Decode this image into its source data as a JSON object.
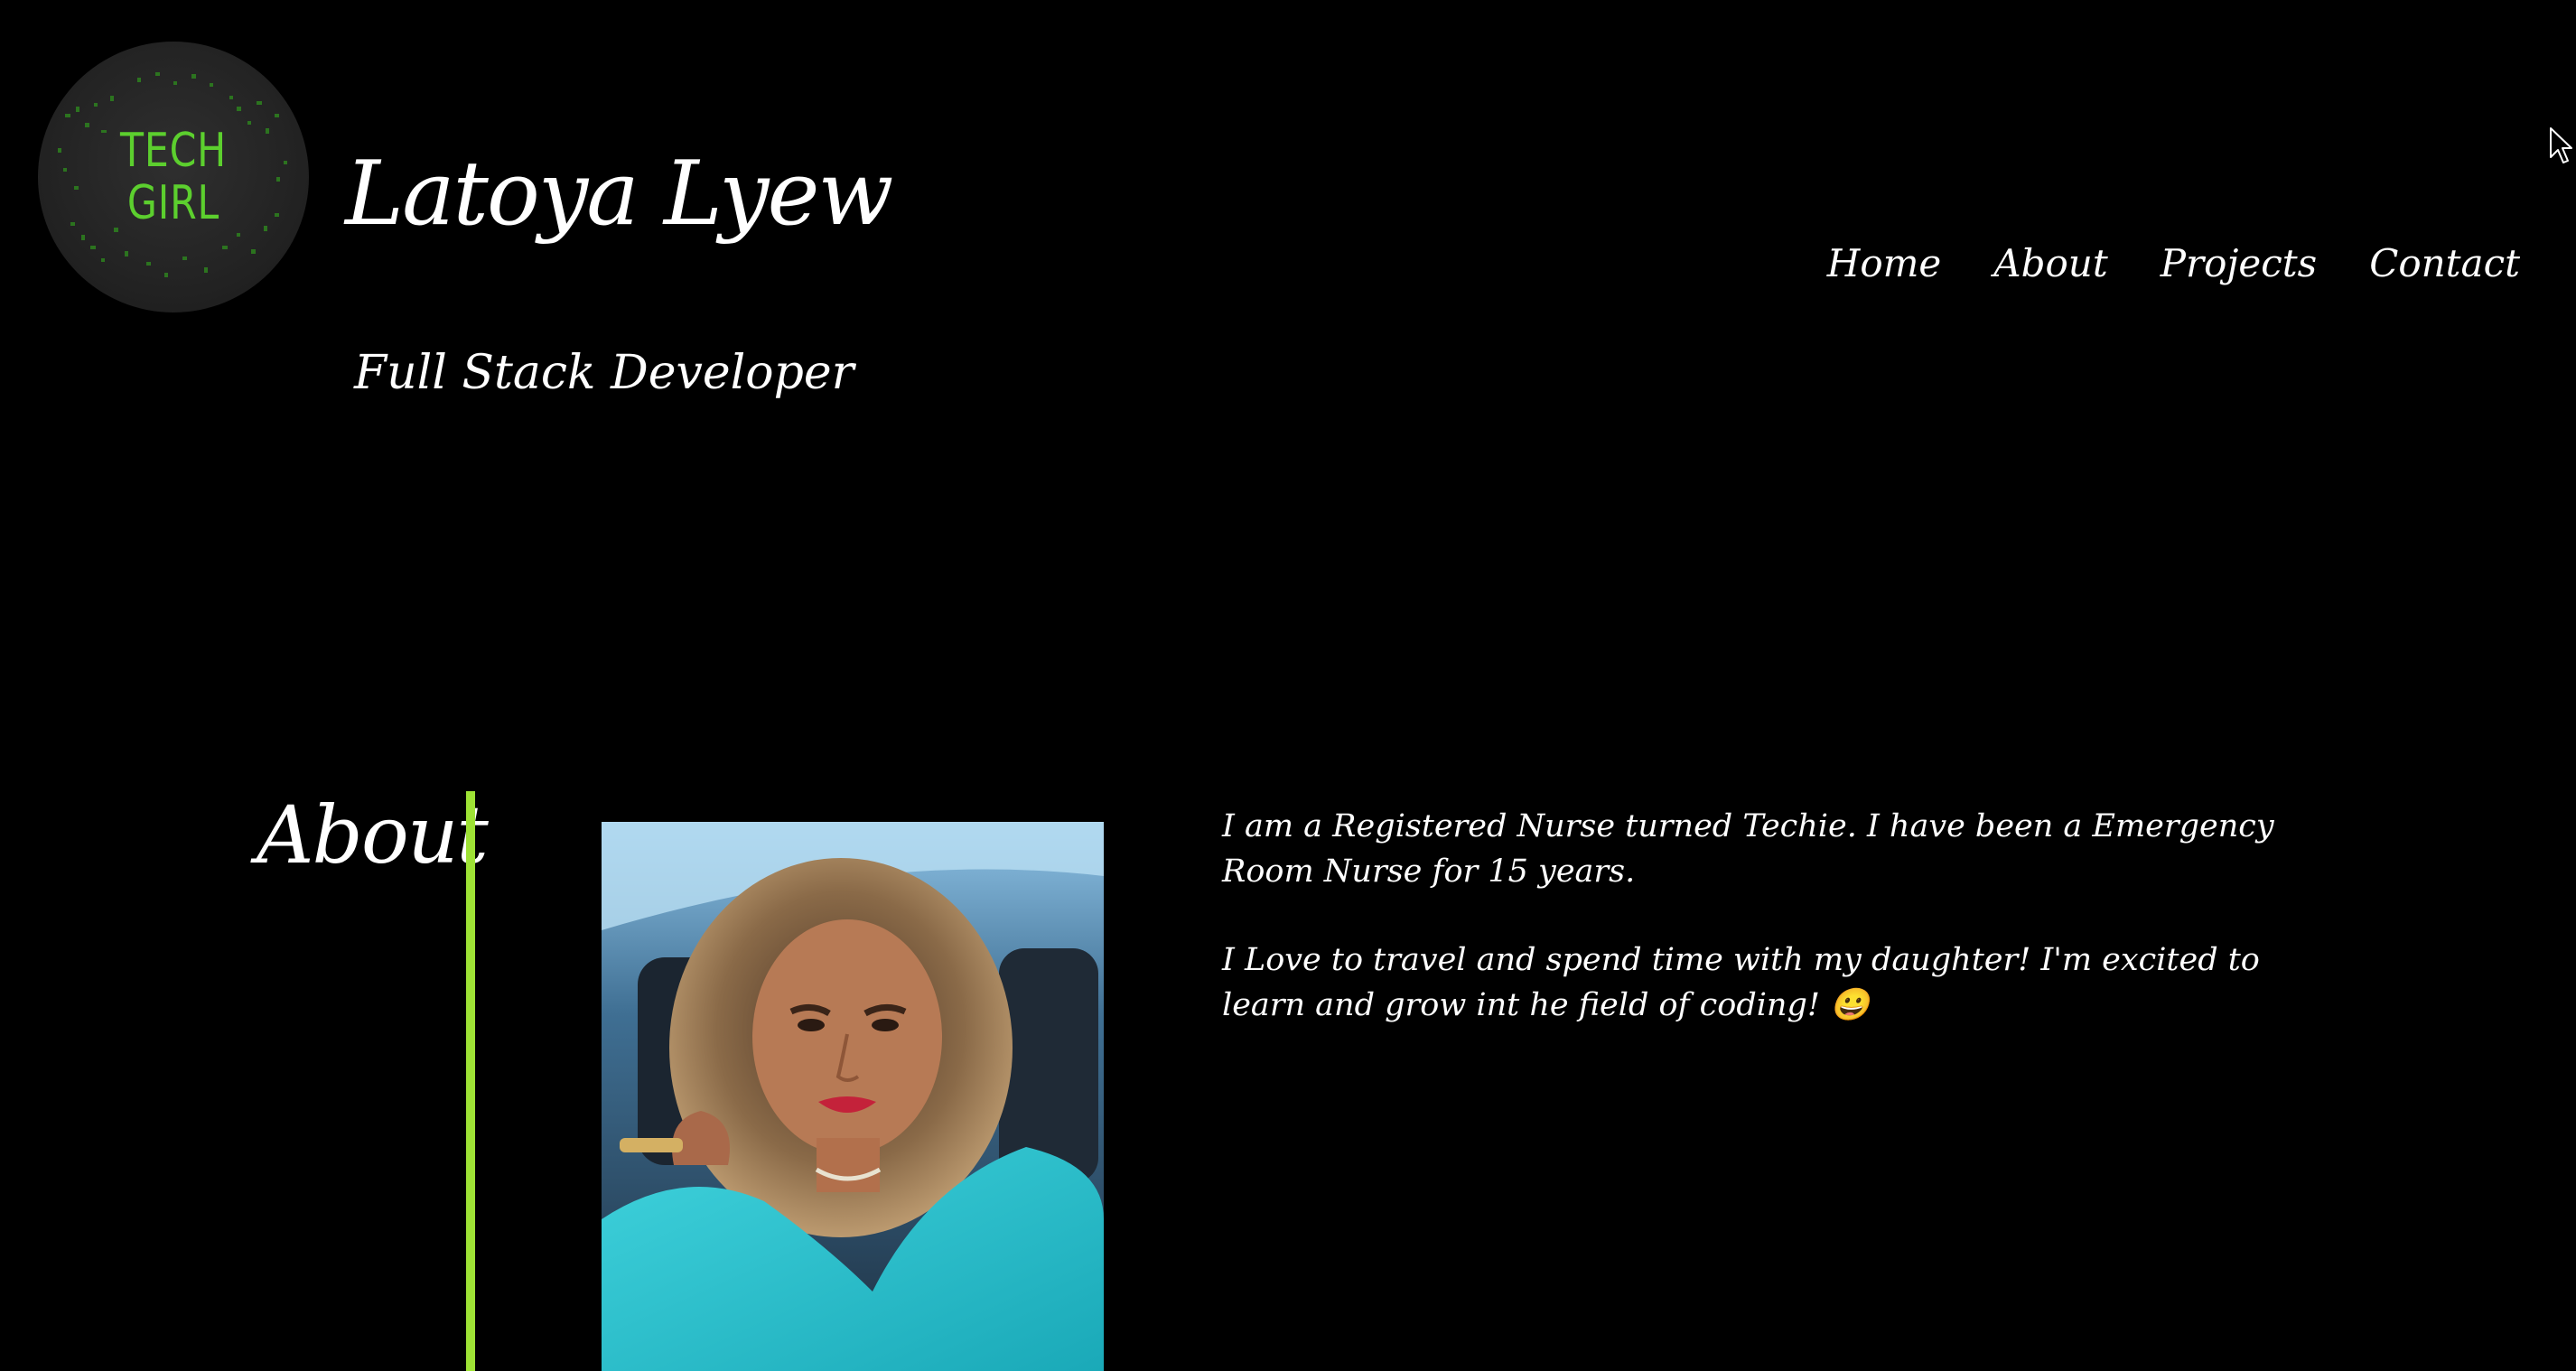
{
  "colors": {
    "background": "#000000",
    "text": "#ffffff",
    "accent_line": "#9ee235",
    "logo_green": "#5ccf2e"
  },
  "header": {
    "logo": {
      "line1": "TECH",
      "line2": "GIRL"
    },
    "name": "Latoya Lyew",
    "subtitle": "Full Stack Developer",
    "nav": [
      "Home",
      "About",
      "Projects",
      "Contact"
    ]
  },
  "about": {
    "heading": "About",
    "paragraph1": "I am a Registered Nurse turned Techie. I have been a Emergency Room Nurse for 15 years.",
    "paragraph2": "I Love to travel and spend time with my daughter! I'm excited to learn and grow int he field of coding! 😀"
  },
  "icons": {
    "cursor": "mouse-pointer-icon",
    "photo": "profile-photo"
  }
}
